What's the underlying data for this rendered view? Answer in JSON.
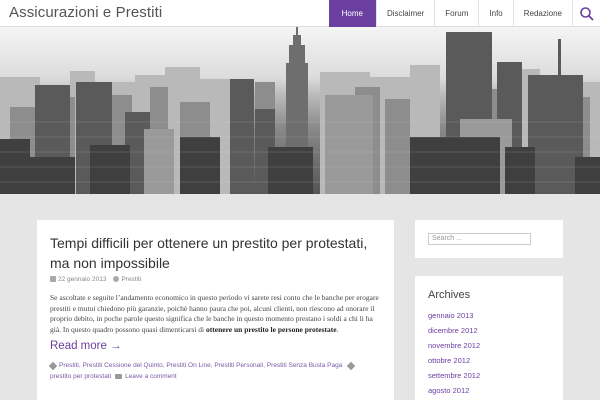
{
  "site": {
    "title": "Assicurazioni e Prestiti"
  },
  "nav": {
    "items": [
      {
        "label": "Home",
        "active": true
      },
      {
        "label": "Disclaimer"
      },
      {
        "label": "Forum"
      },
      {
        "label": "Info"
      },
      {
        "label": "Redazione"
      }
    ],
    "search_icon": "search-icon"
  },
  "hero": {
    "image": "city-skyline-grayscale"
  },
  "post": {
    "title": "Tempi difficili per ottenere un prestito per protestati, ma non impossibile",
    "date": "22 gennaio 2013",
    "author": "Prestiti",
    "excerpt": "Se ascoltate e seguite l’andamento economico in questo periodo vi sarete resi conto che le banche per erogare prestiti e mutui chiedono più garanzie, poichè hanno paura che poi, alcuni clienti, non riescono ad onorare il proprio debito, in poche parole questo significa che le banche in questo momento prestano i soldi a chi li ha già. In questo quadro possono quasi dimenticarsi di",
    "excerpt_strong": "ottenere un prestito le persone protestate",
    "excerpt_end": ".",
    "read_more": "Read more →",
    "tags": [
      "Prestiti",
      "Prestiti Cessione del Quinto",
      "Prestiti On Line",
      "Prestiti Personali",
      "Prestiti Senza Busta Paga",
      "prestito per protestati"
    ],
    "comment_link": "Leave a comment"
  },
  "sidebar": {
    "search_placeholder": "Search ...",
    "archives_title": "Archives",
    "archives": [
      "gennaio 2013",
      "dicembre 2012",
      "novembre 2012",
      "ottobre 2012",
      "settembre 2012",
      "agosto 2012"
    ]
  },
  "colors": {
    "accent": "#6b3fa0",
    "background": "#e5e5e5"
  }
}
